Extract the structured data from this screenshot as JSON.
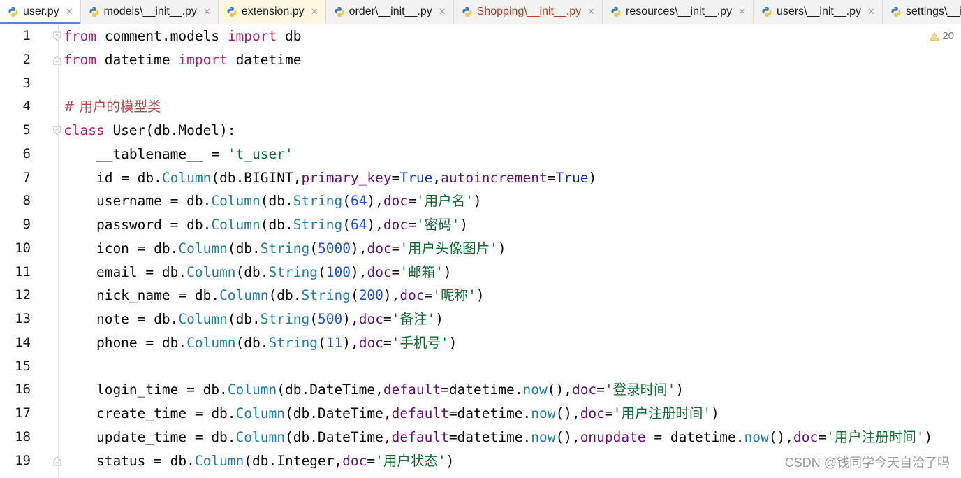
{
  "tabs": [
    {
      "label": "user.py",
      "state": "active"
    },
    {
      "label": "models\\__init__.py",
      "state": "normal"
    },
    {
      "label": "extension.py",
      "state": "modified"
    },
    {
      "label": "order\\__init__.py",
      "state": "normal"
    },
    {
      "label": "Shopping\\__init__.py",
      "state": "error"
    },
    {
      "label": "resources\\__init__.py",
      "state": "normal"
    },
    {
      "label": "users\\__init__.py",
      "state": "normal"
    },
    {
      "label": "settings\\__in",
      "state": "normal"
    }
  ],
  "editor": {
    "warning_count": "20",
    "line_numbers": [
      "1",
      "2",
      "3",
      "4",
      "5",
      "6",
      "7",
      "8",
      "9",
      "10",
      "11",
      "12",
      "13",
      "14",
      "15",
      "16",
      "17",
      "18",
      "19"
    ]
  },
  "code": [
    [
      [
        "kw",
        "from"
      ],
      [
        "txt",
        " comment.models "
      ],
      [
        "kw",
        "import"
      ],
      [
        "txt",
        " db"
      ]
    ],
    [
      [
        "kw",
        "from"
      ],
      [
        "txt",
        " datetime "
      ],
      [
        "kw",
        "import"
      ],
      [
        "txt",
        " datetime"
      ]
    ],
    [],
    [
      [
        "cm",
        "# 用户的模型类"
      ]
    ],
    [
      [
        "kw",
        "class"
      ],
      [
        "txt",
        " User(db.Model):"
      ]
    ],
    [
      [
        "txt",
        "    __tablename__ = "
      ],
      [
        "s",
        "'t_user'"
      ]
    ],
    [
      [
        "txt",
        "    id = db."
      ],
      [
        "fn",
        "Column"
      ],
      [
        "txt",
        "(db.BIGINT,"
      ],
      [
        "param",
        "primary_key"
      ],
      [
        "txt",
        "="
      ],
      [
        "bool",
        "True"
      ],
      [
        "txt",
        ","
      ],
      [
        "param",
        "autoincrement"
      ],
      [
        "txt",
        "="
      ],
      [
        "bool",
        "True"
      ],
      [
        "txt",
        ")"
      ]
    ],
    [
      [
        "txt",
        "    username = db."
      ],
      [
        "fn",
        "Column"
      ],
      [
        "txt",
        "(db."
      ],
      [
        "fn",
        "String"
      ],
      [
        "txt",
        "("
      ],
      [
        "num",
        "64"
      ],
      [
        "txt",
        "),"
      ],
      [
        "param",
        "doc"
      ],
      [
        "txt",
        "="
      ],
      [
        "s",
        "'用户名'"
      ],
      [
        "txt",
        ")"
      ]
    ],
    [
      [
        "txt",
        "    password = db."
      ],
      [
        "fn",
        "Column"
      ],
      [
        "txt",
        "(db."
      ],
      [
        "fn",
        "String"
      ],
      [
        "txt",
        "("
      ],
      [
        "num",
        "64"
      ],
      [
        "txt",
        "),"
      ],
      [
        "param",
        "doc"
      ],
      [
        "txt",
        "="
      ],
      [
        "s",
        "'密码'"
      ],
      [
        "txt",
        ")"
      ]
    ],
    [
      [
        "txt",
        "    icon = db."
      ],
      [
        "fn",
        "Column"
      ],
      [
        "txt",
        "(db."
      ],
      [
        "fn",
        "String"
      ],
      [
        "txt",
        "("
      ],
      [
        "num",
        "5000"
      ],
      [
        "txt",
        "),"
      ],
      [
        "param",
        "doc"
      ],
      [
        "txt",
        "="
      ],
      [
        "s",
        "'用户头像图片'"
      ],
      [
        "txt",
        ")"
      ]
    ],
    [
      [
        "txt",
        "    email = db."
      ],
      [
        "fn",
        "Column"
      ],
      [
        "txt",
        "(db."
      ],
      [
        "fn",
        "String"
      ],
      [
        "txt",
        "("
      ],
      [
        "num",
        "100"
      ],
      [
        "txt",
        "),"
      ],
      [
        "param",
        "doc"
      ],
      [
        "txt",
        "="
      ],
      [
        "s",
        "'邮箱'"
      ],
      [
        "txt",
        ")"
      ]
    ],
    [
      [
        "txt",
        "    nick_name = db."
      ],
      [
        "fn",
        "Column"
      ],
      [
        "txt",
        "(db."
      ],
      [
        "fn",
        "String"
      ],
      [
        "txt",
        "("
      ],
      [
        "num",
        "200"
      ],
      [
        "txt",
        "),"
      ],
      [
        "param",
        "doc"
      ],
      [
        "txt",
        "="
      ],
      [
        "s",
        "'昵称'"
      ],
      [
        "txt",
        ")"
      ]
    ],
    [
      [
        "txt",
        "    note = db."
      ],
      [
        "fn",
        "Column"
      ],
      [
        "txt",
        "(db."
      ],
      [
        "fn",
        "String"
      ],
      [
        "txt",
        "("
      ],
      [
        "num",
        "500"
      ],
      [
        "txt",
        "),"
      ],
      [
        "param",
        "doc"
      ],
      [
        "txt",
        "="
      ],
      [
        "s",
        "'备注'"
      ],
      [
        "txt",
        ")"
      ]
    ],
    [
      [
        "txt",
        "    phone = db."
      ],
      [
        "fn",
        "Column"
      ],
      [
        "txt",
        "(db."
      ],
      [
        "fn",
        "String"
      ],
      [
        "txt",
        "("
      ],
      [
        "num",
        "11"
      ],
      [
        "txt",
        "),"
      ],
      [
        "param",
        "doc"
      ],
      [
        "txt",
        "="
      ],
      [
        "s",
        "'手机号'"
      ],
      [
        "txt",
        ")"
      ]
    ],
    [],
    [
      [
        "txt",
        "    login_time = db."
      ],
      [
        "fn",
        "Column"
      ],
      [
        "txt",
        "(db.DateTime,"
      ],
      [
        "param",
        "default"
      ],
      [
        "txt",
        "=datetime."
      ],
      [
        "fn",
        "now"
      ],
      [
        "txt",
        "(),"
      ],
      [
        "param",
        "doc"
      ],
      [
        "txt",
        "="
      ],
      [
        "s",
        "'登录时间'"
      ],
      [
        "txt",
        ")"
      ]
    ],
    [
      [
        "txt",
        "    create_time = db."
      ],
      [
        "fn",
        "Column"
      ],
      [
        "txt",
        "(db.DateTime,"
      ],
      [
        "param",
        "default"
      ],
      [
        "txt",
        "=datetime."
      ],
      [
        "fn",
        "now"
      ],
      [
        "txt",
        "(),"
      ],
      [
        "param",
        "doc"
      ],
      [
        "txt",
        "="
      ],
      [
        "s",
        "'用户注册时间'"
      ],
      [
        "txt",
        ")"
      ]
    ],
    [
      [
        "txt",
        "    update_time = db."
      ],
      [
        "fn",
        "Column"
      ],
      [
        "txt",
        "(db.DateTime,"
      ],
      [
        "param",
        "default"
      ],
      [
        "txt",
        "=datetime."
      ],
      [
        "fn",
        "now"
      ],
      [
        "txt",
        "(),"
      ],
      [
        "param",
        "onupdate"
      ],
      [
        "txt",
        " = datetime."
      ],
      [
        "fn",
        "now"
      ],
      [
        "txt",
        "(),"
      ],
      [
        "param",
        "doc"
      ],
      [
        "txt",
        "="
      ],
      [
        "s",
        "'用户注册时间'"
      ],
      [
        "txt",
        ")"
      ]
    ],
    [
      [
        "txt",
        "    status = db."
      ],
      [
        "fn",
        "Column"
      ],
      [
        "txt",
        "(db.Integer,"
      ],
      [
        "param",
        "doc"
      ],
      [
        "txt",
        "="
      ],
      [
        "s",
        "'用户状态'"
      ],
      [
        "txt",
        ")"
      ]
    ]
  ],
  "watermark": "CSDN @钱同学今天自洽了吗",
  "colors": {
    "accent": "#4a87dd",
    "keyword": "#b31d6d",
    "function": "#1f7daf",
    "param": "#660e7a",
    "string": "#0a6b2a",
    "comment": "#b24c4c",
    "number": "#1750eb"
  }
}
